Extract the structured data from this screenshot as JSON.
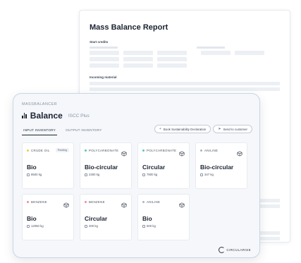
{
  "report": {
    "title": "Mass Balance Report",
    "section1": "Start credits",
    "section2": "Incoming material"
  },
  "app": {
    "brand": "MASSBALANCER",
    "title": "Balance",
    "subtitle": "ISCC Plus",
    "tabs": [
      {
        "label": "INPUT INVENTORY",
        "active": true
      },
      {
        "label": "OUTPUT INVENTORY",
        "active": false
      }
    ],
    "actions": {
      "book_label": "Book Sustainability Declaration",
      "send_label": "Send to customer"
    },
    "cards": [
      {
        "name": "CRUDE OIL",
        "dot_color": "#f2c94c",
        "badge": "Pending",
        "label": "Bio",
        "qty": "8500 kg",
        "cube": false
      },
      {
        "name": "POLYCARBONATE",
        "dot_color": "#56c4c9",
        "badge": "",
        "label": "Bio-circular",
        "qty": "2300 kg",
        "cube": true
      },
      {
        "name": "POLYCARBONATE",
        "dot_color": "#56c4c9",
        "badge": "",
        "label": "Circular",
        "qty": "7800 kg",
        "cube": true
      },
      {
        "name": "ANILINE",
        "dot_color": "#a6b4c6",
        "badge": "",
        "label": "Bio-circular",
        "qty": "347 kg",
        "cube": true
      },
      {
        "name": "BENZENE",
        "dot_color": "#f08aa0",
        "badge": "",
        "label": "Bio",
        "qty": "12050 kg",
        "cube": true
      },
      {
        "name": "BENZENE",
        "dot_color": "#f08aa0",
        "badge": "",
        "label": "Circular",
        "qty": "400 kg",
        "cube": true
      },
      {
        "name": "ANILINE",
        "dot_color": "#a6b4c6",
        "badge": "",
        "label": "Bio",
        "qty": "500 kg",
        "cube": true
      }
    ],
    "footer_logo": "CIRCULARISE"
  }
}
